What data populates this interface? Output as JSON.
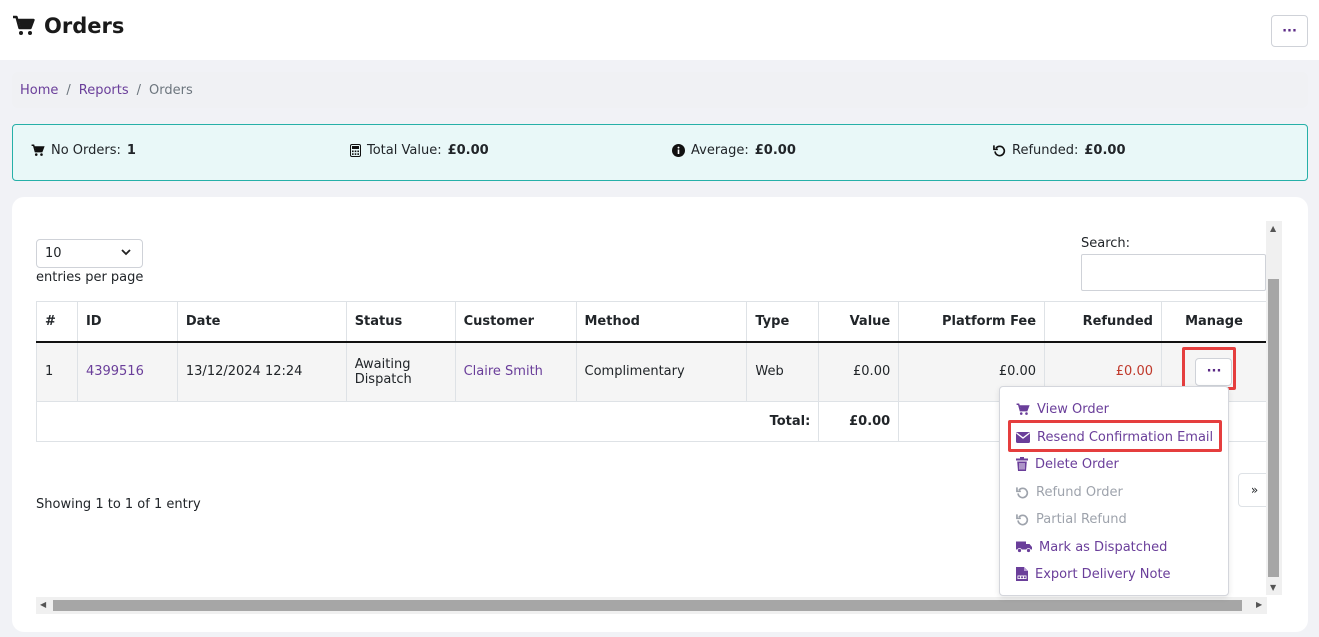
{
  "page": {
    "title": "Orders",
    "top_menu_label": "···"
  },
  "breadcrumb": {
    "items": [
      "Home",
      "Reports",
      "Orders"
    ]
  },
  "stats": [
    {
      "icon": "cart-icon",
      "label": "No Orders:",
      "value": "1"
    },
    {
      "icon": "calculator-icon",
      "label": "Total Value:",
      "value": "£0.00"
    },
    {
      "icon": "info-icon",
      "label": "Average:",
      "value": "£0.00"
    },
    {
      "icon": "refund-icon",
      "label": "Refunded:",
      "value": "£0.00"
    }
  ],
  "table_controls": {
    "page_size": "10",
    "entries_label": "entries per page",
    "search_label": "Search:",
    "search_value": ""
  },
  "table": {
    "headers": [
      "#",
      "ID",
      "Date",
      "Status",
      "Customer",
      "Method",
      "Type",
      "Value",
      "Platform Fee",
      "Refunded",
      "Manage"
    ],
    "rows": [
      {
        "num": "1",
        "id": "4399516",
        "date": "13/12/2024 12:24",
        "status_line1": "Awaiting",
        "status_line2": "Dispatch",
        "customer": "Claire Smith",
        "method": "Complimentary",
        "type": "Web",
        "value": "£0.00",
        "platform_fee": "£0.00",
        "refunded": "£0.00",
        "manage_label": "···"
      }
    ],
    "footer": {
      "label": "Total:",
      "value": "£0.00"
    }
  },
  "pagination": {
    "showing": "Showing 1 to 1 of 1 entry",
    "next": "»"
  },
  "dropdown": {
    "items": [
      {
        "label": "View Order",
        "icon": "cart-icon",
        "enabled": true
      },
      {
        "label": "Resend Confirmation Email",
        "icon": "envelope-icon",
        "enabled": true
      },
      {
        "label": "Delete Order",
        "icon": "trash-icon",
        "enabled": true
      },
      {
        "label": "Refund Order",
        "icon": "refund-icon",
        "enabled": false
      },
      {
        "label": "Partial Refund",
        "icon": "refund-icon",
        "enabled": false
      },
      {
        "label": "Mark as Dispatched",
        "icon": "truck-icon",
        "enabled": true
      },
      {
        "label": "Export Delivery Note",
        "icon": "pdf-file-icon",
        "enabled": true
      }
    ]
  },
  "colors": {
    "accent": "#6a3e9a",
    "stats_border": "#26b0a8",
    "stats_bg": "#e9f8f8",
    "highlight": "#e53e3e",
    "refunded": "#c0392b",
    "disabled": "#9ea3ac"
  }
}
